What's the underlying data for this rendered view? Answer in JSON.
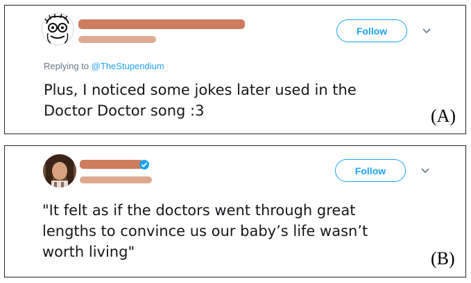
{
  "panel_a": {
    "reply_prefix": "Replying to",
    "reply_handle": "@TheStupendium",
    "follow_label": "Follow",
    "tweet_lines": [
      "Plus, I noticed some jokes later used in the",
      "Doctor Doctor song :3"
    ],
    "label": "(A)",
    "avatar_icon": "cartoon-face-avatar",
    "menu_icon": "chevron-down-icon"
  },
  "panel_b": {
    "follow_label": "Follow",
    "tweet_lines": [
      "\"It felt as if the doctors went through great",
      "lengths to convince us our baby’s life wasn’t",
      "worth living\""
    ],
    "label": "(B)",
    "avatar_icon": "profile-photo-avatar",
    "verified_icon": "verified-badge-icon",
    "menu_icon": "chevron-down-icon"
  },
  "colors": {
    "twitter_blue": "#1da1f2",
    "redaction": "#c9714f",
    "secondary_text": "#657786"
  }
}
